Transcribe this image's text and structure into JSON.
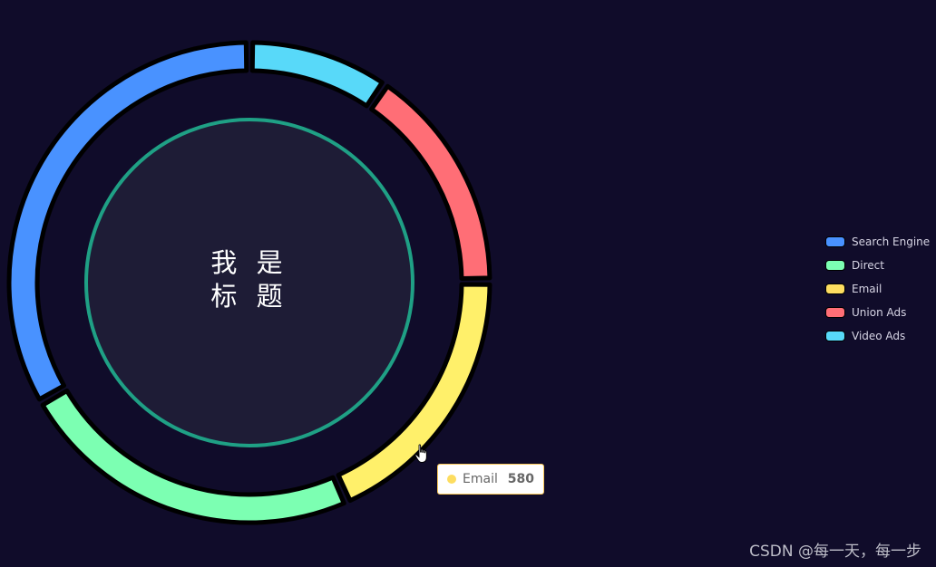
{
  "chart_data": {
    "type": "pie",
    "variant": "donut",
    "title": "我是\n标题",
    "title_lines": [
      "我 是",
      "标 题"
    ],
    "categories": [
      "Search Engine",
      "Direct",
      "Email",
      "Union Ads",
      "Video Ads"
    ],
    "values": [
      1048,
      735,
      580,
      484,
      300
    ],
    "colors": [
      "#4992ff",
      "#7cffb2",
      "#fddd60",
      "#ff6e76",
      "#58d9f9"
    ],
    "slice_fill_colors": [
      "#4992ff",
      "#7cffb2",
      "#fff06a",
      "#ff6e76",
      "#58d9f9"
    ],
    "direction": "counterclockwise",
    "start": "top",
    "legend": {
      "position": "right",
      "orient": "vertical"
    },
    "tooltip": {
      "name": "Email",
      "value": "580",
      "color": "#fddd60"
    }
  },
  "theme": {
    "background": "#100c2a",
    "center_fill": "#1e1c36",
    "center_ring": "#1fa085"
  },
  "watermark": "CSDN @每一天，每一步"
}
